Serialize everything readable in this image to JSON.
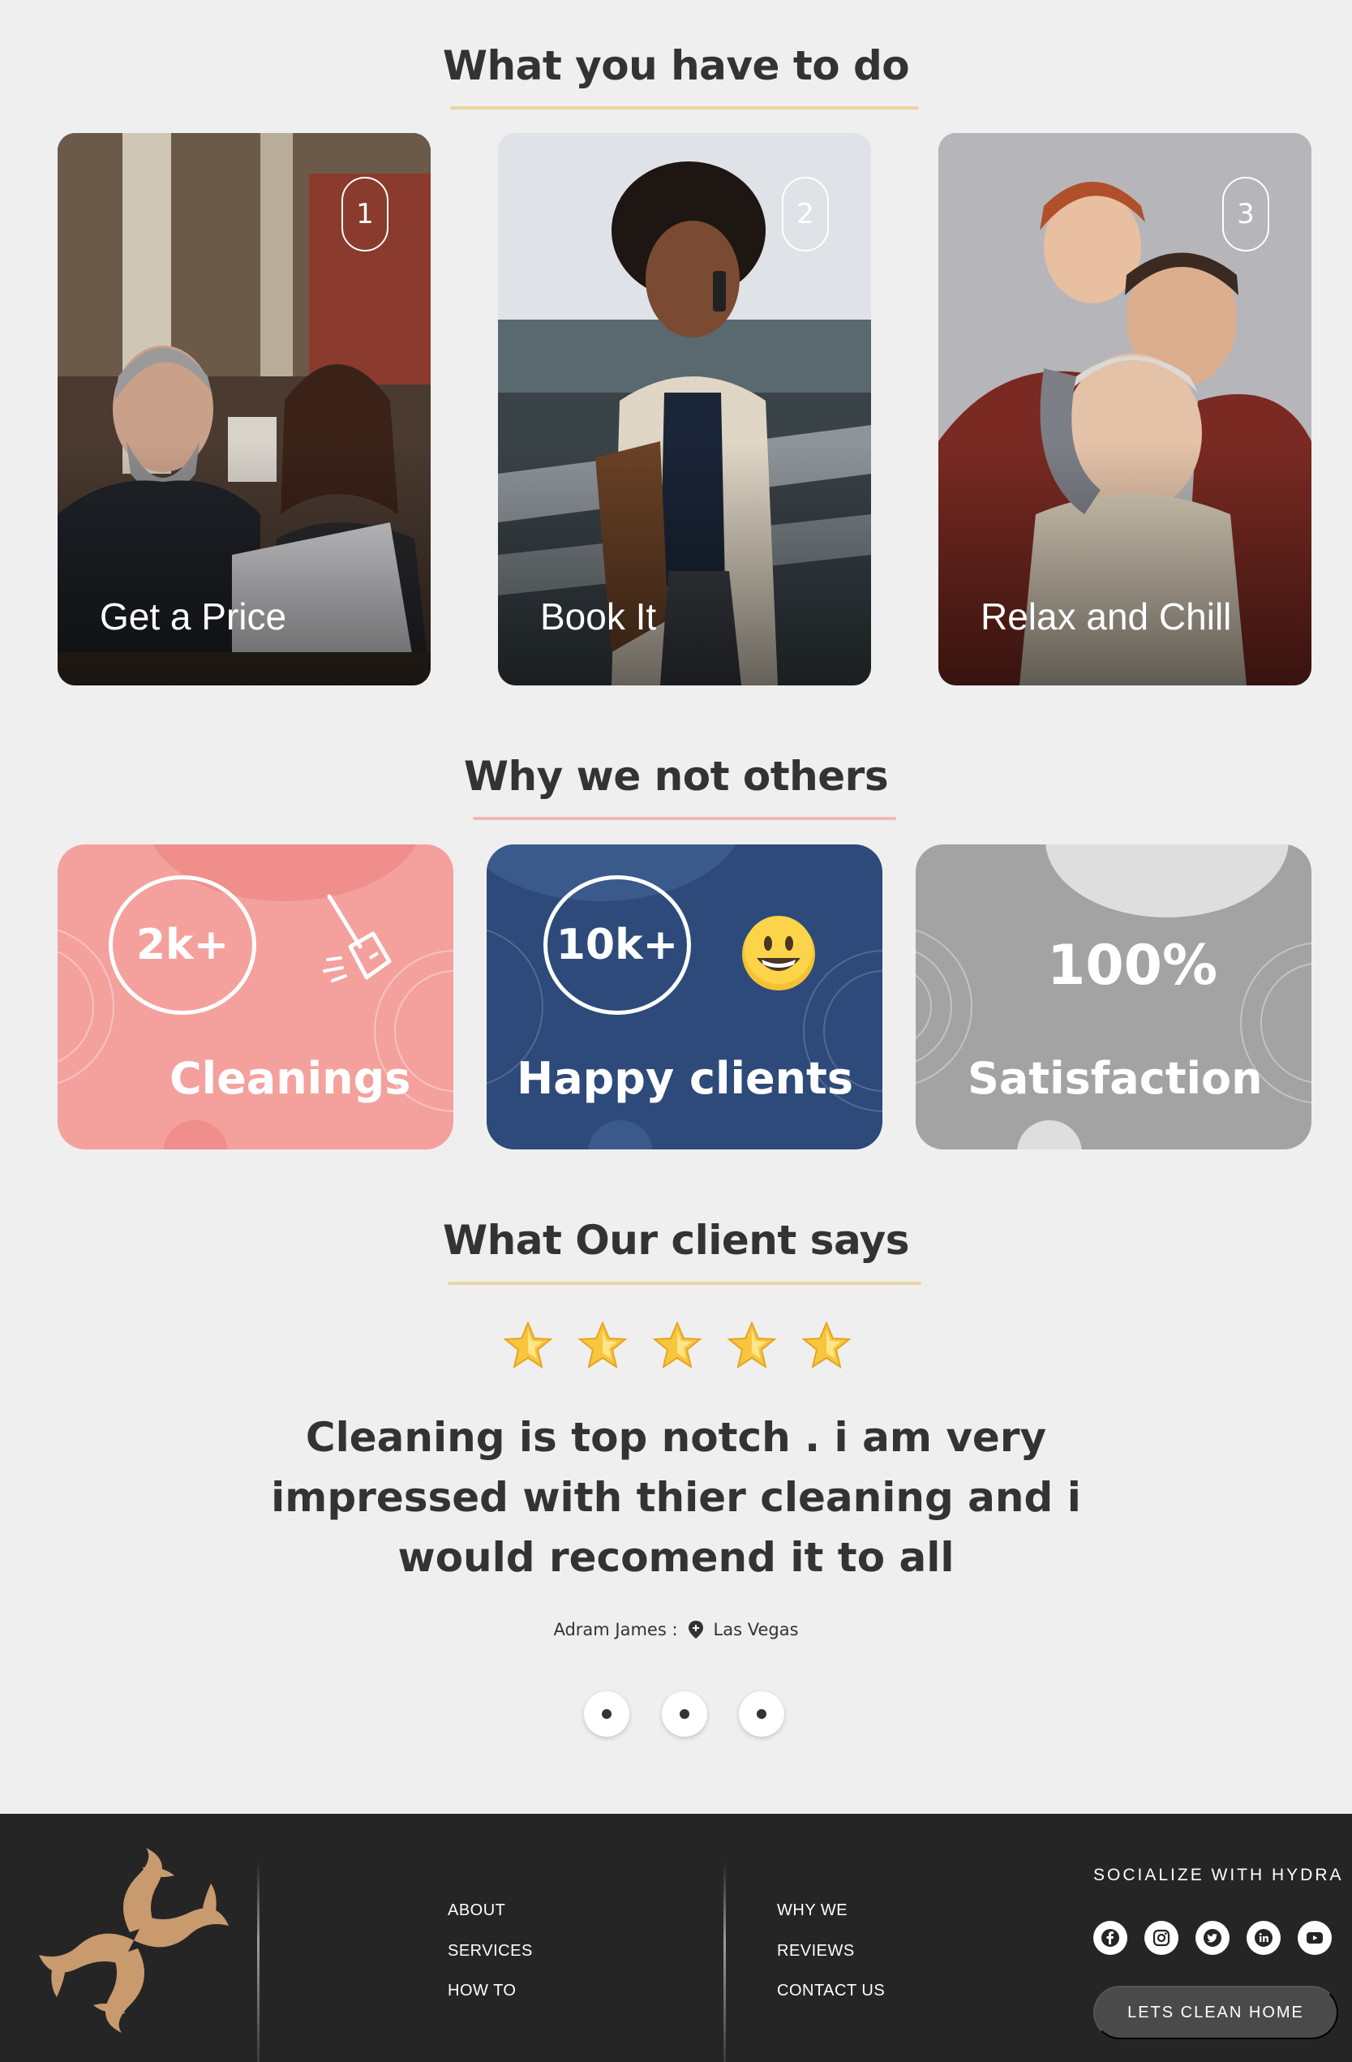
{
  "steps_section": {
    "title": "What you have to do",
    "underline_color": "#ecd6a0",
    "cards": [
      {
        "number": "1",
        "label": "Get a Price"
      },
      {
        "number": "2",
        "label": "Book It"
      },
      {
        "number": "3",
        "label": "Relax and Chill"
      }
    ]
  },
  "why_section": {
    "title": "Why we not others",
    "underline_color": "#f2b8b4",
    "cards": [
      {
        "stat": "2k+",
        "label": "Cleanings",
        "color": "#f4a19e",
        "icon": "broom-icon"
      },
      {
        "stat": "10k+",
        "label": "Happy clients",
        "color": "#2d4a7a",
        "icon": "smiley-icon"
      },
      {
        "stat": "100%",
        "label": "Satisfaction",
        "color": "#a3a3a3"
      }
    ]
  },
  "testimonial_section": {
    "title": "What Our client says",
    "underline_color": "#ecd6a0",
    "rating": 5,
    "quote": "Cleaning is top notch . i am very impressed with thier cleaning and i would recomend it to all",
    "author": "Adram James :",
    "location": "Las Vegas",
    "pagination_count": 3
  },
  "footer": {
    "links_col1": [
      "ABOUT",
      "SERVICES",
      "HOW TO"
    ],
    "links_col2": [
      "WHY WE",
      "REVIEWS",
      "CONTACT US"
    ],
    "social_title": "SOCIALIZE WITH HYDRA",
    "social_icons": [
      "facebook-icon",
      "instagram-icon",
      "twitter-icon",
      "linkedin-icon",
      "youtube-icon"
    ],
    "cta_label": "LETS CLEAN HOME",
    "logo_color": "#c89a6e"
  }
}
